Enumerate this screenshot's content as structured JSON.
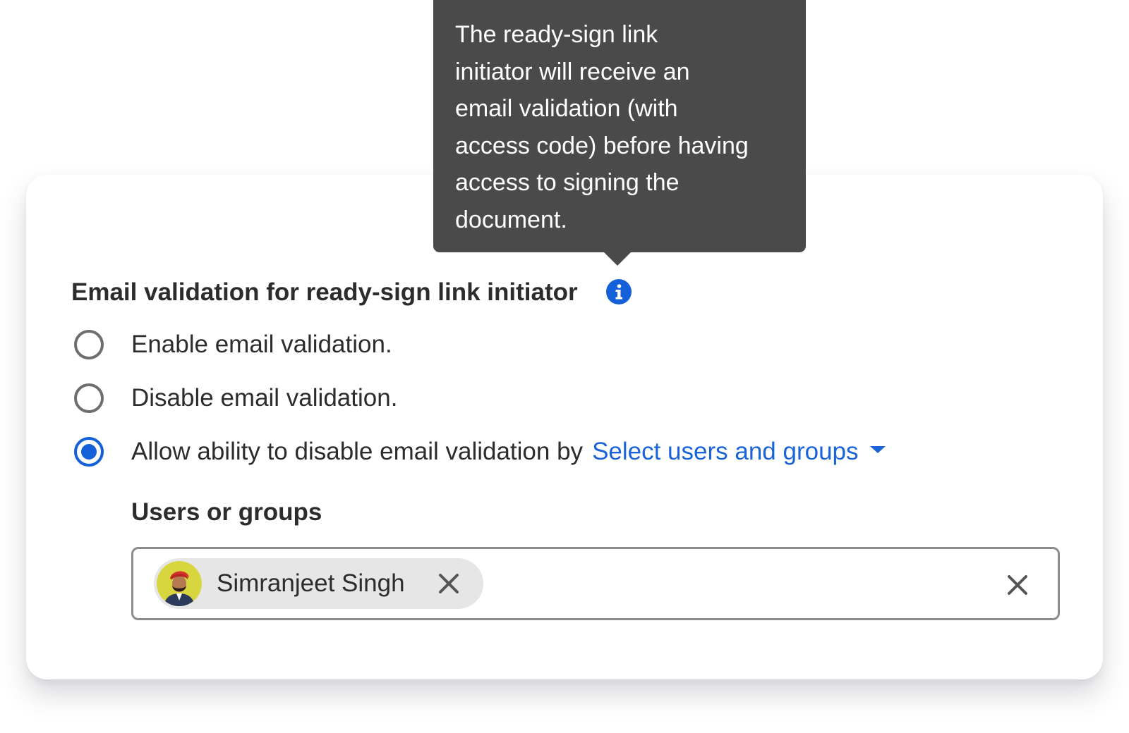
{
  "tooltip": {
    "lines": [
      "The ready-sign link",
      "initiator will receive an",
      "email validation (with",
      "access code) before having",
      "access to signing the",
      "document."
    ],
    "background_color": "#4a4a4a"
  },
  "section": {
    "title": "Email validation for ready-sign link initiator",
    "info_icon": "info-icon"
  },
  "options": [
    {
      "label": "Enable email validation.",
      "selected": false
    },
    {
      "label": "Disable email validation.",
      "selected": false
    },
    {
      "label": "Allow ability to disable email validation by",
      "selected": true
    }
  ],
  "select_users": {
    "label": "Select users and groups",
    "icon": "caret-down-icon"
  },
  "users_or_groups": {
    "label": "Users or groups",
    "chips": [
      {
        "name": "Simranjeet Singh",
        "avatar": "user-avatar",
        "remove_icon": "close-icon"
      }
    ],
    "clear_icon": "close-icon"
  },
  "colors": {
    "accent": "#1360d8",
    "link": "#1a64d8",
    "text": "#2c2c2c",
    "chip_background": "#e6e6e6"
  }
}
